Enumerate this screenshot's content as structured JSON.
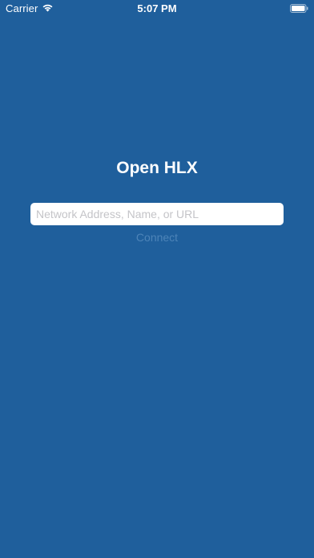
{
  "status_bar": {
    "carrier": "Carrier",
    "time": "5:07 PM",
    "icons": [
      "wifi-icon",
      "battery-icon"
    ]
  },
  "main": {
    "title": "Open HLX",
    "address_input": {
      "value": "",
      "placeholder": "Network Address, Name, or URL"
    },
    "connect_label": "Connect"
  },
  "colors": {
    "background": "#1f5f9c",
    "connect_disabled": "#4d84b8"
  }
}
